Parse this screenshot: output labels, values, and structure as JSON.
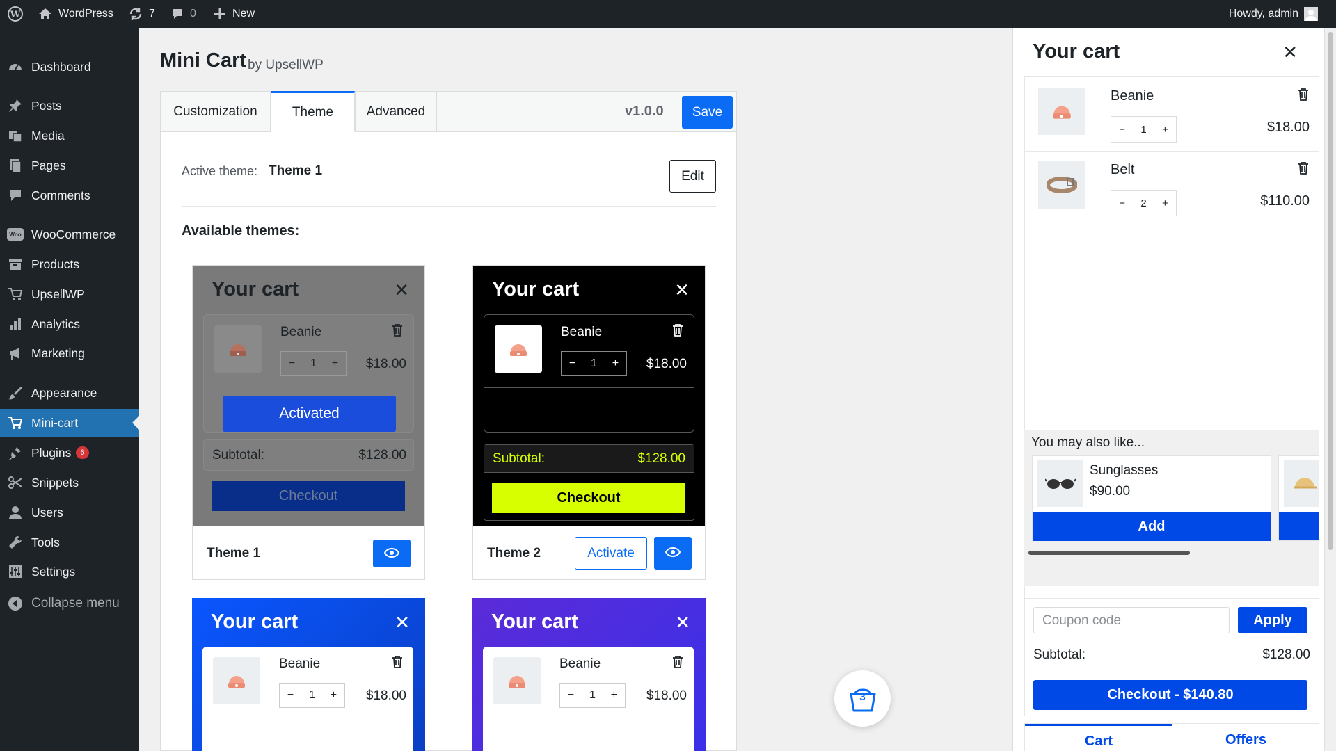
{
  "adminbar": {
    "site_name": "WordPress",
    "updates_count": "7",
    "comments_count": "0",
    "new_label": "New",
    "howdy": "Howdy, admin"
  },
  "sidebar": {
    "items": [
      {
        "label": "Dashboard",
        "icon": "dashboard-icon"
      },
      {
        "label": "Posts",
        "icon": "pin-icon"
      },
      {
        "label": "Media",
        "icon": "media-icon"
      },
      {
        "label": "Pages",
        "icon": "pages-icon"
      },
      {
        "label": "Comments",
        "icon": "comment-icon"
      },
      {
        "label": "WooCommerce",
        "icon": "woo-icon"
      },
      {
        "label": "Products",
        "icon": "archive-icon"
      },
      {
        "label": "UpsellWP",
        "icon": "cart-icon"
      },
      {
        "label": "Analytics",
        "icon": "bar-chart-icon"
      },
      {
        "label": "Marketing",
        "icon": "megaphone-icon"
      },
      {
        "label": "Appearance",
        "icon": "brush-icon"
      },
      {
        "label": "Mini-cart",
        "icon": "cart-icon"
      },
      {
        "label": "Plugins",
        "icon": "plug-icon",
        "badge": "6"
      },
      {
        "label": "Snippets",
        "icon": "scissors-icon"
      },
      {
        "label": "Users",
        "icon": "user-icon"
      },
      {
        "label": "Tools",
        "icon": "wrench-icon"
      },
      {
        "label": "Settings",
        "icon": "settings-icon"
      },
      {
        "label": "Collapse menu",
        "icon": "collapse-icon"
      }
    ]
  },
  "page": {
    "title": "Mini Cart",
    "byline": "by UpsellWP",
    "tabs": [
      "Customization",
      "Theme",
      "Advanced"
    ],
    "active_tab": "Theme",
    "version": "v1.0.0",
    "save_label": "Save",
    "active_theme_label": "Active theme:",
    "active_theme_value": "Theme 1",
    "edit_label": "Edit",
    "available_label": "Available themes:"
  },
  "themes": [
    {
      "name": "Theme 1",
      "cart_title": "Your cart",
      "item_name": "Beanie",
      "qty": "1",
      "price": "$18.00",
      "subtotal_label": "Subtotal:",
      "subtotal_value": "$128.00",
      "checkout_label": "Checkout",
      "activated_label": "Activated"
    },
    {
      "name": "Theme 2",
      "cart_title": "Your cart",
      "item_name": "Beanie",
      "qty": "1",
      "price": "$18.00",
      "subtotal_label": "Subtotal:",
      "subtotal_value": "$128.00",
      "checkout_label": "Checkout",
      "activate_label": "Activate"
    },
    {
      "cart_title": "Your cart",
      "item_name": "Beanie",
      "qty": "1",
      "price": "$18.00"
    },
    {
      "cart_title": "Your cart",
      "item_name": "Beanie",
      "qty": "1",
      "price": "$18.00"
    }
  ],
  "floating_cart": {
    "count": "3"
  },
  "cart": {
    "title": "Your cart",
    "items": [
      {
        "name": "Beanie",
        "qty": "1",
        "price": "$18.00"
      },
      {
        "name": "Belt",
        "qty": "2",
        "price": "$110.00"
      }
    ],
    "upsell_title": "You may also like...",
    "upsell": {
      "name": "Sunglasses",
      "price": "$90.00",
      "add_label": "Add"
    },
    "coupon_placeholder": "Coupon code",
    "apply_label": "Apply",
    "subtotal_label": "Subtotal:",
    "subtotal_value": "$128.00",
    "checkout_label": "Checkout - $140.80",
    "tabs": [
      "Cart",
      "Offers"
    ]
  },
  "colors": {
    "wp_dark": "#1d2327",
    "wp_blue": "#2271b1",
    "primary_blue": "#0a6cf5",
    "cart_blue": "#0049e6",
    "theme2_accent": "#d8ff00"
  }
}
